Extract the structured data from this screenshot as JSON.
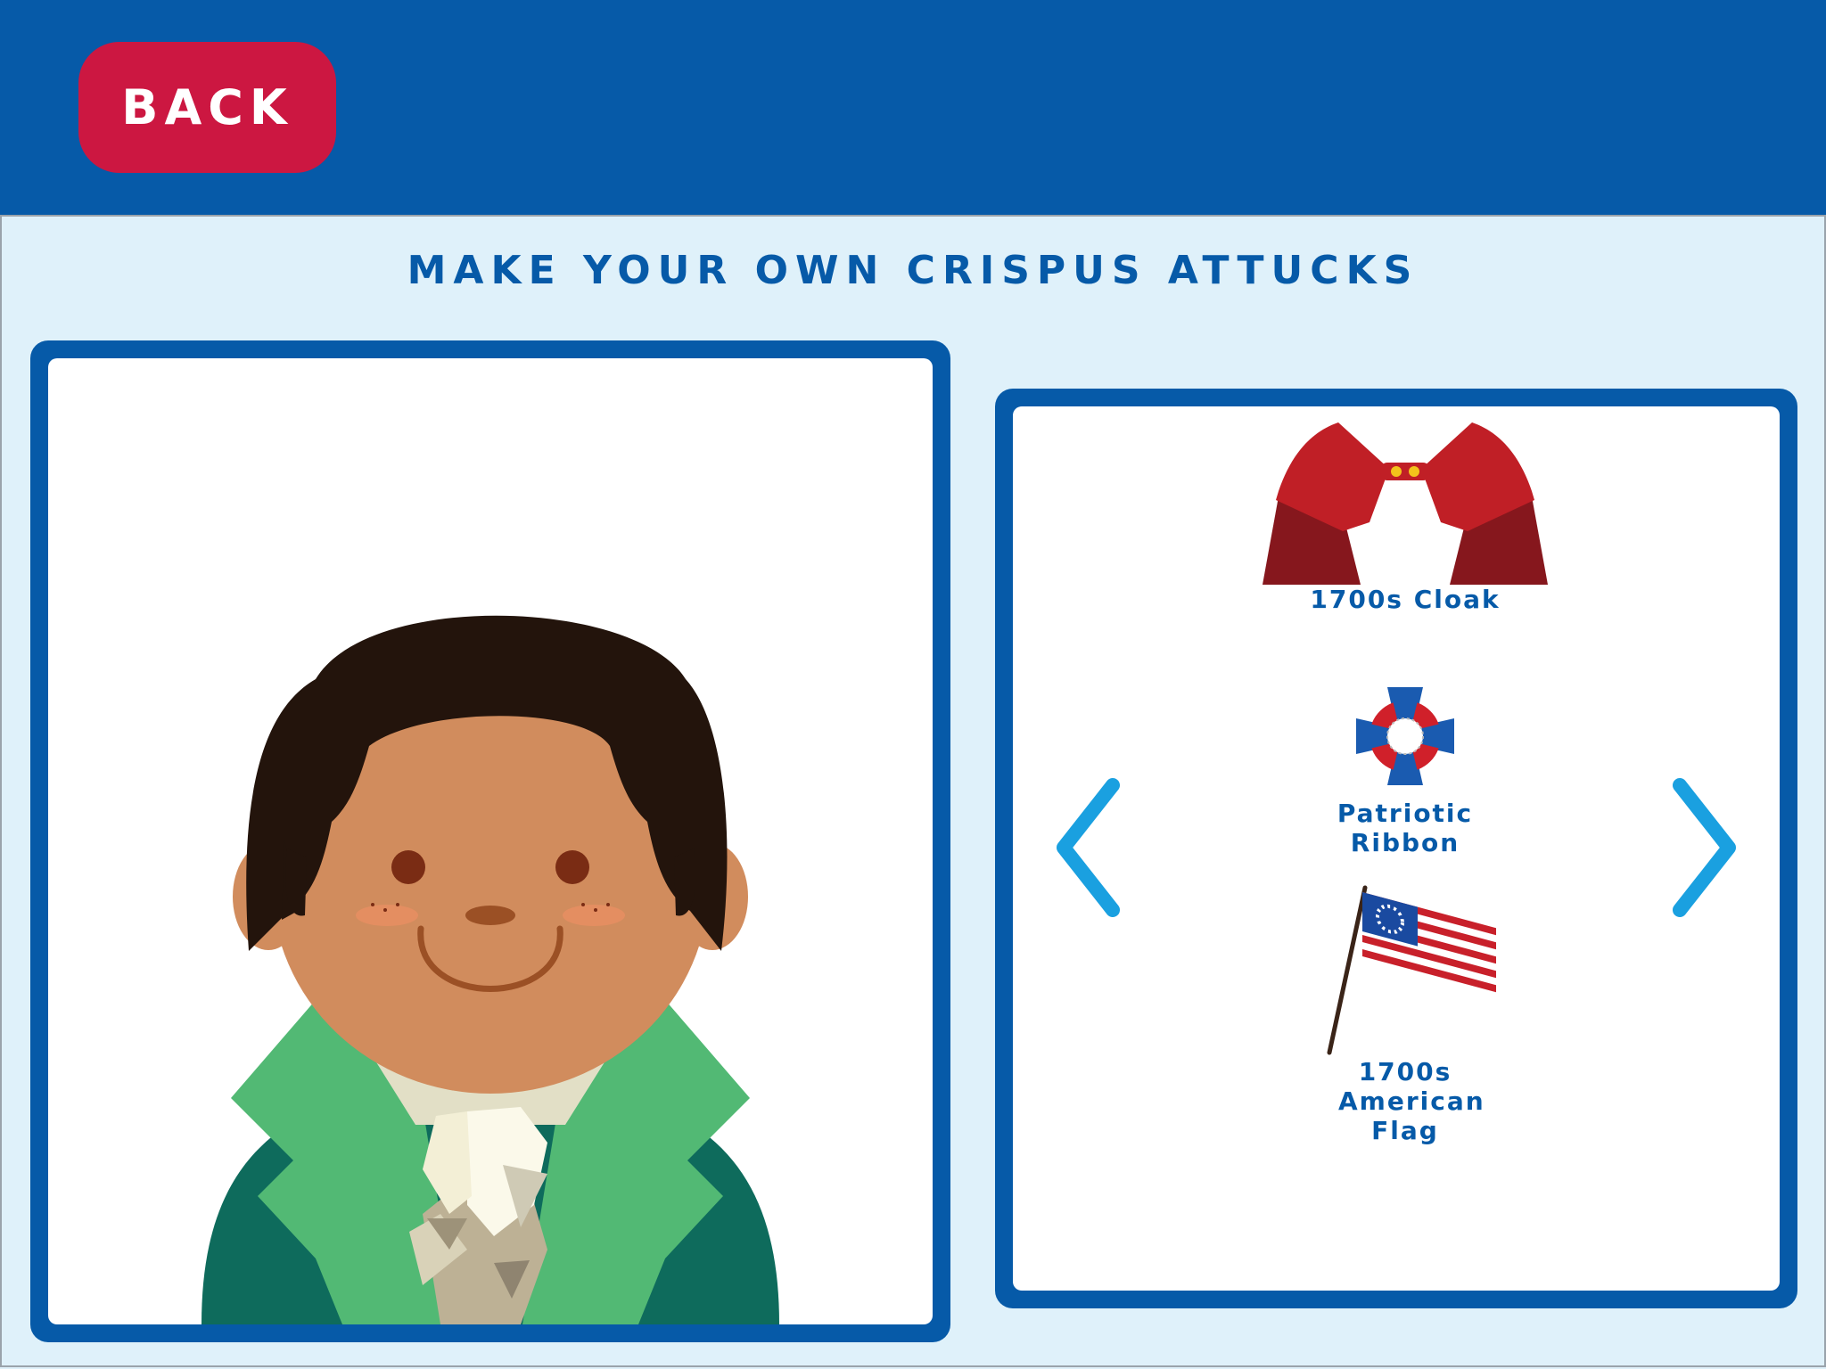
{
  "header": {
    "back_label": "BACK"
  },
  "page": {
    "title": "MAKE YOUR OWN CRISPUS ATTUCKS"
  },
  "items": [
    {
      "label": "1700s Cloak",
      "icon": "cloak-icon"
    },
    {
      "label": "Patriotic Ribbon",
      "icon": "ribbon-icon"
    },
    {
      "label": "1700s American Flag",
      "icon": "flag-icon"
    }
  ],
  "nav": {
    "prev": "chevron-left-icon",
    "next": "chevron-right-icon"
  },
  "colors": {
    "header": "#065aa8",
    "back_button": "#cc1741",
    "background": "#dff1fa",
    "frame": "#065aa8",
    "arrow": "#1aa0e0"
  }
}
